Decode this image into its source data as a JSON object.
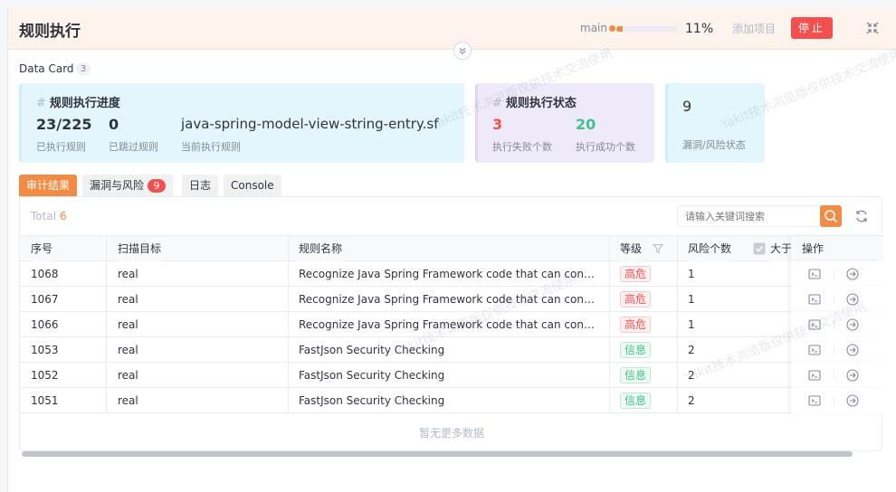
{
  "header": {
    "title": "规则执行",
    "branch": "main",
    "progress_percent": 11,
    "progress_label": "11%",
    "add_label": "添加项目",
    "stop_label": "停止"
  },
  "datacard": {
    "label": "Data Card",
    "count": "3"
  },
  "cards": {
    "progress": {
      "title": "规则执行进度",
      "executed_value": "23/225",
      "executed_label": "已执行规则",
      "skipped_value": "0",
      "skipped_label": "已跳过规则",
      "current_value": "java-spring-model-view-string-entry.sf",
      "current_label": "当前执行规则"
    },
    "status": {
      "title": "规则执行状态",
      "fail_value": "3",
      "fail_label": "执行失败个数",
      "success_value": "20",
      "success_label": "执行成功个数"
    },
    "vuln": {
      "value": "9",
      "label": "漏洞/风险状态"
    }
  },
  "tabs": [
    {
      "label": "审计结果"
    },
    {
      "label": "漏洞与风险",
      "badge": "9"
    },
    {
      "label": "日志"
    },
    {
      "label": "Console"
    }
  ],
  "toolbar": {
    "total_label": "Total",
    "total_value": "6",
    "search_placeholder": "请输入关键词搜索"
  },
  "table": {
    "columns": {
      "id": "序号",
      "target": "扫描目标",
      "rule": "规则名称",
      "level": "等级",
      "risk": "风险个数",
      "gt": "大于",
      "ops": "操作"
    },
    "rows": [
      {
        "id": "1068",
        "target": "real",
        "rule": "Recognize Java Spring Framework code that can control the view",
        "level": "高危",
        "risk": "1"
      },
      {
        "id": "1067",
        "target": "real",
        "rule": "Recognize Java Spring Framework code that can control the view",
        "level": "高危",
        "risk": "1"
      },
      {
        "id": "1066",
        "target": "real",
        "rule": "Recognize Java Spring Framework code that can control the view",
        "level": "高危",
        "risk": "1"
      },
      {
        "id": "1053",
        "target": "real",
        "rule": "FastJson Security Checking",
        "level": "信息",
        "risk": "2"
      },
      {
        "id": "1052",
        "target": "real",
        "rule": "FastJson Security Checking",
        "level": "信息",
        "risk": "2"
      },
      {
        "id": "1051",
        "target": "real",
        "rule": "FastJson Security Checking",
        "level": "信息",
        "risk": "2"
      }
    ],
    "no_more": "暂无更多数据"
  },
  "watermark": "Yakit技术浏览版仅供技术交流使用",
  "colors": {
    "accent": "#f28b44",
    "danger": "#f44f4f",
    "success": "#46c08b"
  }
}
